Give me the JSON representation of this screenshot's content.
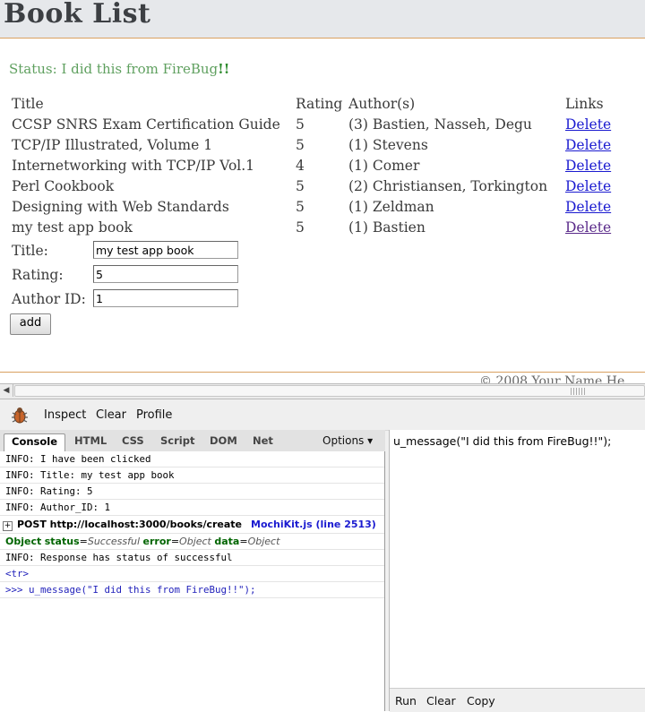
{
  "page": {
    "title": "Book List",
    "status_text": "Status: I did this from FireBug",
    "status_bang": "!!",
    "columns": [
      "Title",
      "Rating",
      "Author(s)",
      "Links"
    ],
    "books": [
      {
        "title": "CCSP SNRS Exam Certification Guide",
        "rating": "5",
        "authors": "(3) Bastien, Nasseh, Degu",
        "link": "Delete"
      },
      {
        "title": "TCP/IP Illustrated, Volume 1",
        "rating": "5",
        "authors": "(1) Stevens",
        "link": "Delete"
      },
      {
        "title": "Internetworking with TCP/IP Vol.1",
        "rating": "4",
        "authors": "(1) Comer",
        "link": "Delete"
      },
      {
        "title": "Perl Cookbook",
        "rating": "5",
        "authors": "(2) Christiansen, Torkington",
        "link": "Delete"
      },
      {
        "title": "Designing with Web Standards",
        "rating": "5",
        "authors": "(1) Zeldman",
        "link": "Delete"
      },
      {
        "title": "my test app book",
        "rating": "5",
        "authors": "(1) Bastien",
        "link": "Delete"
      }
    ],
    "form": {
      "title_label": "Title:",
      "title_value": "my test app book",
      "rating_label": "Rating:",
      "rating_value": "5",
      "author_label": "Author ID:",
      "author_value": "1",
      "add_label": "add"
    },
    "footer": "© 2008 Your Name He"
  },
  "firebug": {
    "toolbar": {
      "inspect": "Inspect",
      "clear": "Clear",
      "profile": "Profile"
    },
    "tabs": [
      "Console",
      "HTML",
      "CSS",
      "Script",
      "DOM",
      "Net"
    ],
    "options": "Options ▾",
    "console": {
      "logs1": [
        "INFO: I have been clicked",
        "INFO: Title:  my test app book",
        "INFO: Rating:  5",
        "INFO: Author_ID:  1"
      ],
      "post": "POST http://localhost:3000/books/create",
      "post_src": "MochiKit.js (line 2513)",
      "object": {
        "label": "Object",
        "k1": "status",
        "v1": "Successful",
        "k2": "error",
        "v2": "Object",
        "k3": "data",
        "v3": "Object"
      },
      "response": "INFO: Response has status of successful",
      "tr": "<tr>",
      "command": ">>> u_message(\"I did this from FireBug!!\");"
    },
    "command_line": {
      "text": "u_message(\"I did this from FireBug!!\");",
      "run": "Run",
      "clear": "Clear",
      "copy": "Copy"
    }
  }
}
